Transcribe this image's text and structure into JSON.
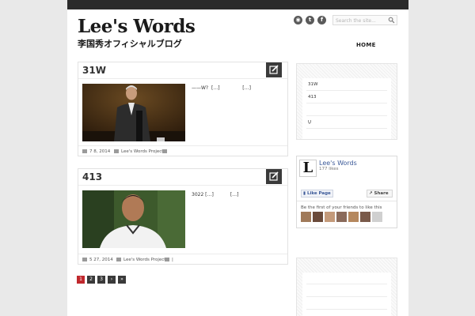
{
  "site": {
    "title": "Lee's Words",
    "subtitle": "李国秀オフィシャルブログ"
  },
  "header": {
    "social": [
      {
        "icon": "rss-icon",
        "glyph": "◉"
      },
      {
        "icon": "twitter-icon",
        "glyph": "t"
      },
      {
        "icon": "facebook-icon",
        "glyph": "f"
      }
    ],
    "search_placeholder": "Search the site..."
  },
  "nav": {
    "home_label": "HOME"
  },
  "posts": [
    {
      "title": "31W",
      "excerpt_text": "——W?",
      "excerpt_more_1": "[…]",
      "excerpt_more_2": "[…]",
      "date": "7 8, 2014",
      "author": "Lee's Words Project",
      "comments": ""
    },
    {
      "title": "413",
      "excerpt_text": "3022 […]",
      "excerpt_more_1": "",
      "excerpt_more_2": "[…]",
      "date": "5 27, 2014",
      "author": "Lee's Words Project",
      "comments": "|"
    }
  ],
  "pagination": {
    "pages": [
      "1",
      "2",
      "3",
      "›",
      "»"
    ],
    "active": "1"
  },
  "sidebar": {
    "recent_posts": [
      "31W",
      "413",
      "",
      "Ų"
    ],
    "facebook": {
      "logo_letter": "L",
      "page_name": "Lee's Words",
      "likes": "177 likes",
      "like_button": "Like Page",
      "share_button": "Share",
      "friends_text": "Be the first of your friends to like this"
    }
  },
  "colors": {
    "topbar": "#2b2b2b",
    "pager_active": "#c0282d",
    "facebook_blue": "#3b5998"
  }
}
